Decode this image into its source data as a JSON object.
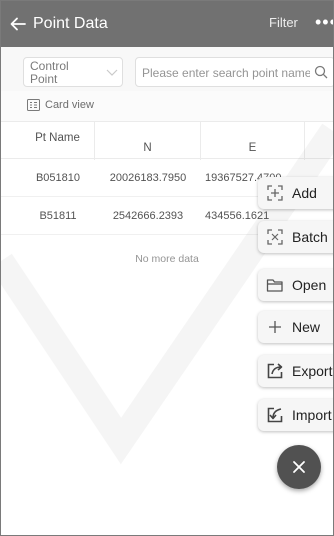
{
  "header": {
    "title": "Point Data",
    "filter_label": "Filter",
    "more_label": "•••"
  },
  "search": {
    "type_selected": "Control Point",
    "placeholder": "Please enter search point name"
  },
  "view": {
    "card_view_label": "Card view"
  },
  "table": {
    "columns": [
      "Pt Name",
      "N",
      "E",
      ""
    ],
    "rows": [
      {
        "name": "B051810",
        "n": "20026183.7950",
        "e": "19367527.4700"
      },
      {
        "name": "B51811",
        "n": "2542666.2393",
        "e": "434556.1621"
      }
    ],
    "footer": "No more data"
  },
  "fab_menu": {
    "items": [
      {
        "label": "Add",
        "icon": "add-point-icon"
      },
      {
        "label": "Batch",
        "icon": "batch-icon"
      },
      {
        "label": "Open",
        "icon": "folder-open-icon"
      },
      {
        "label": "New",
        "icon": "plus-icon"
      },
      {
        "label": "Export",
        "icon": "export-icon"
      },
      {
        "label": "Import",
        "icon": "import-icon"
      }
    ],
    "close_icon": "close-icon"
  },
  "colors": {
    "header_bg": "#4a4a4a",
    "fab_bg": "#515151",
    "menu_item_bg": "#f6f6f6"
  }
}
